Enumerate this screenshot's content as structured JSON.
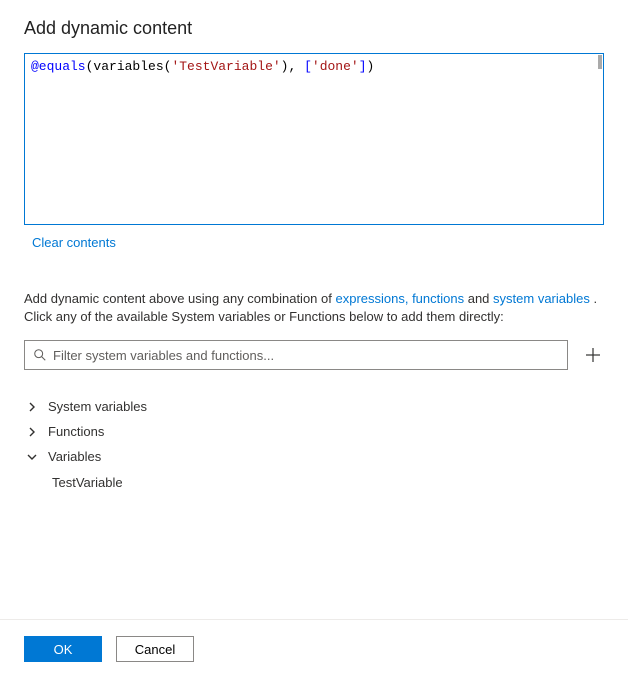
{
  "title": "Add dynamic content",
  "expression_tokens": [
    {
      "cls": "tok-at",
      "text": "@equals"
    },
    {
      "cls": "tok-paren",
      "text": "("
    },
    {
      "cls": "tok-fn",
      "text": "variables"
    },
    {
      "cls": "tok-paren",
      "text": "("
    },
    {
      "cls": "tok-str",
      "text": "'TestVariable'"
    },
    {
      "cls": "tok-paren",
      "text": "), "
    },
    {
      "cls": "tok-brkt",
      "text": "["
    },
    {
      "cls": "tok-str",
      "text": "'done'"
    },
    {
      "cls": "tok-brkt",
      "text": "]"
    },
    {
      "cls": "tok-paren",
      "text": ")"
    }
  ],
  "clear_label": "Clear contents",
  "hint": {
    "prefix": "Add dynamic content above using any combination of ",
    "link1": "expressions, functions",
    "mid": " and ",
    "link2": "system variables",
    "suffix": " . Click any of the available System variables or Functions below to add them directly:"
  },
  "filter_placeholder": "Filter system variables and functions...",
  "categories": [
    {
      "label": "System variables",
      "expanded": false,
      "children": []
    },
    {
      "label": "Functions",
      "expanded": false,
      "children": []
    },
    {
      "label": "Variables",
      "expanded": true,
      "children": [
        "TestVariable"
      ]
    }
  ],
  "buttons": {
    "ok": "OK",
    "cancel": "Cancel"
  }
}
